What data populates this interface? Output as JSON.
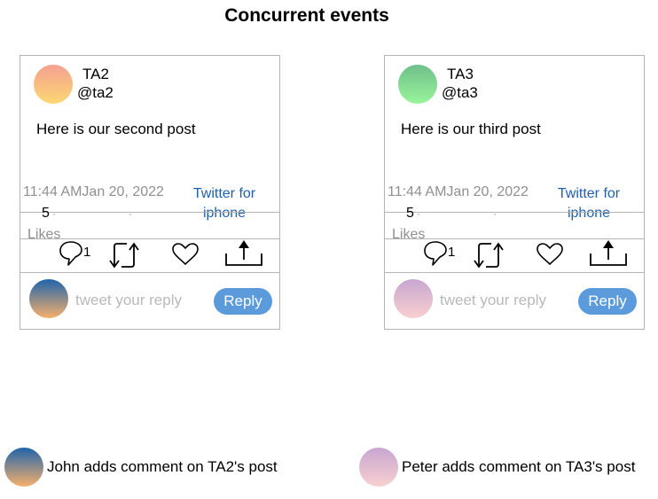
{
  "title": "Concurrent events",
  "posts": [
    {
      "name": "TA2",
      "handle": "@ta2",
      "text": "Here is our second post",
      "timestamp": "11:44 AMJan 20, 2022",
      "source": "Twitter for iphone",
      "likes_count": "5",
      "likes_label": "Likes",
      "replies_count": "1",
      "reply_placeholder": "tweet your reply",
      "reply_button": "Reply"
    },
    {
      "name": "TA3",
      "handle": "@ta3",
      "text": "Here is our third post",
      "timestamp": "11:44 AMJan 20, 2022",
      "source": "Twitter for iphone",
      "likes_count": "5",
      "likes_label": "Likes",
      "replies_count": "1",
      "reply_placeholder": "tweet your reply",
      "reply_button": "Reply"
    }
  ],
  "events": [
    {
      "label": "John adds comment on TA2's post"
    },
    {
      "label": "Peter adds comment on TA3's post"
    }
  ],
  "colors": {
    "reply_button": "#5b9bdc",
    "link": "#1f5fad",
    "muted_text": "#909090"
  }
}
